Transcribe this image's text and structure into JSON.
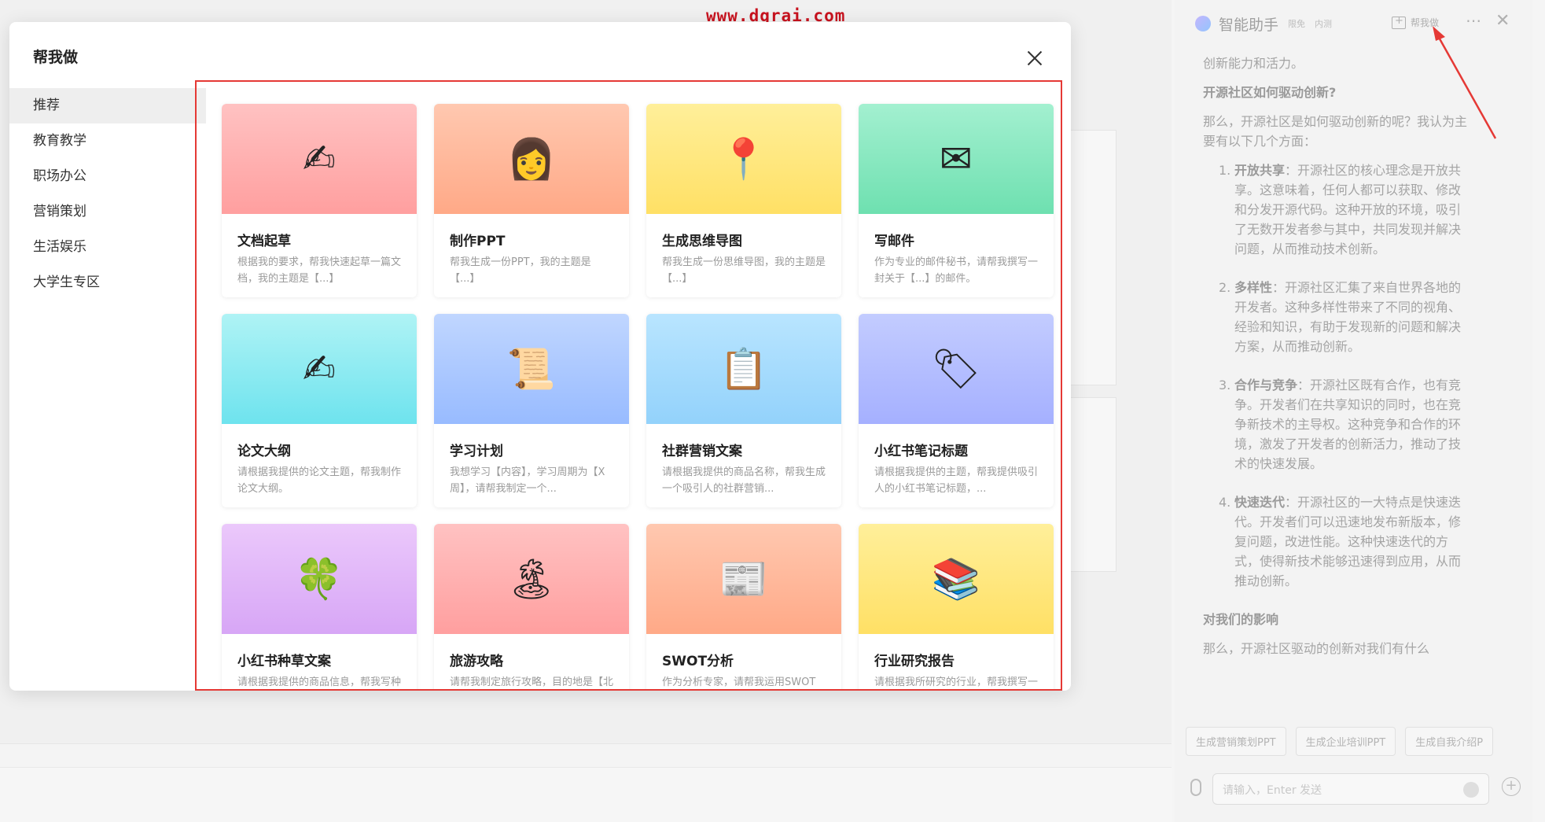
{
  "watermark": "www.dgrai.com",
  "modal": {
    "title": "帮我做",
    "sidebar": [
      "推荐",
      "教育教学",
      "职场办公",
      "营销策划",
      "生活娱乐",
      "大学生专区"
    ],
    "cards": [
      {
        "title": "文档起草",
        "desc": "根据我的要求，帮我快速起草一篇文档，我的主题是【...】",
        "icon": "hand-writing-icon",
        "glyph": "✍",
        "bg": [
          "#ffc2c2",
          "#ff9f9f"
        ]
      },
      {
        "title": "制作PPT",
        "desc": "帮我生成一份PPT，我的主题是【...】",
        "icon": "person-laptop-icon",
        "glyph": "👩",
        "bg": [
          "#ffc8b0",
          "#ffa987"
        ]
      },
      {
        "title": "生成思维导图",
        "desc": "帮我生成一份思维导图，我的主题是【...】",
        "icon": "pushpin-icon",
        "glyph": "📍",
        "bg": [
          "#ffef9a",
          "#ffe065"
        ]
      },
      {
        "title": "写邮件",
        "desc": "作为专业的邮件秘书，请帮我撰写一封关于【...】的邮件。",
        "icon": "email-icon",
        "glyph": "✉",
        "bg": [
          "#a3f0d0",
          "#6ee0b0"
        ]
      },
      {
        "title": "论文大纲",
        "desc": "请根据我提供的论文主题，帮我制作论文大纲。",
        "icon": "hand-writing-icon",
        "glyph": "✍",
        "bg": [
          "#aff3f5",
          "#6ee3ee"
        ]
      },
      {
        "title": "学习计划",
        "desc": "我想学习【内容】，学习周期为【X周】，请帮我制定一个...",
        "icon": "scroll-icon",
        "glyph": "📜",
        "bg": [
          "#c0d6ff",
          "#98bbff"
        ]
      },
      {
        "title": "社群营销文案",
        "desc": "请根据我提供的商品名称，帮我生成一个吸引人的社群营销...",
        "icon": "clipboard-icon",
        "glyph": "📋",
        "bg": [
          "#b9e5ff",
          "#93d2fb"
        ]
      },
      {
        "title": "小红书笔记标题",
        "desc": "请根据我提供的主题，帮我提供吸引人的小红书笔记标题，...",
        "icon": "tag-icon",
        "glyph": "🏷",
        "bg": [
          "#c3ccff",
          "#a5b0ff"
        ]
      },
      {
        "title": "小红书种草文案",
        "desc": "请根据我提供的商品信息，帮我写种草文案",
        "icon": "clover-icon",
        "glyph": "🍀",
        "bg": [
          "#ebc8fb",
          "#d7a6f6"
        ]
      },
      {
        "title": "旅游攻略",
        "desc": "请帮我制定旅行攻略，目的地是【北京】，计划旅行时间...",
        "icon": "island-icon",
        "glyph": "🏝",
        "bg": [
          "#ffc2c2",
          "#ff9f9f"
        ]
      },
      {
        "title": "SWOT分析",
        "desc": "作为分析专家，请帮我运用SWOT分析法对我的项目进行...",
        "icon": "newspaper-roll-icon",
        "glyph": "📰",
        "bg": [
          "#ffc8b0",
          "#ffa987"
        ]
      },
      {
        "title": "行业研究报告",
        "desc": "请根据我所研究的行业，帮我撰写一份行业研究报告",
        "icon": "books-icon",
        "glyph": "📚",
        "bg": [
          "#ffef9a",
          "#ffe065"
        ]
      }
    ]
  },
  "assistant": {
    "title": "智能助手",
    "tag1": "限免",
    "tag2": "内测",
    "action": "帮我做",
    "p1": "创新能力和活力。",
    "h1": "开源社区如何驱动创新?",
    "p2": "那么，开源社区是如何驱动创新的呢？我认为主要有以下几个方面：",
    "items": [
      {
        "num": "1.",
        "bold": "开放共享",
        "text": "：开源社区的核心理念是开放共享。这意味着，任何人都可以获取、修改和分发开源代码。这种开放的环境，吸引了无数开发者参与其中，共同发现并解决问题，从而推动技术创新。"
      },
      {
        "num": "2.",
        "bold": "多样性",
        "text": "：开源社区汇集了来自世界各地的开发者。这种多样性带来了不同的视角、经验和知识，有助于发现新的问题和解决方案，从而推动创新。"
      },
      {
        "num": "3.",
        "bold": "合作与竞争",
        "text": "：开源社区既有合作，也有竞争。开发者们在共享知识的同时，也在竞争新技术的主导权。这种竞争和合作的环境，激发了开发者的创新活力，推动了技术的快速发展。"
      },
      {
        "num": "4.",
        "bold": "快速迭代",
        "text": "：开源社区的一大特点是快速迭代。开发者们可以迅速地发布新版本，修复问题，改进性能。这种快速迭代的方式，使得新技术能够迅速得到应用，从而推动创新。"
      }
    ],
    "h2": "对我们的影响",
    "p3": "那么，开源社区驱动的创新对我们有什么",
    "chips": [
      "生成营销策划PPT",
      "生成企业培训PPT",
      "生成自我介绍P"
    ],
    "input_placeholder": "请输入，Enter 发送"
  }
}
